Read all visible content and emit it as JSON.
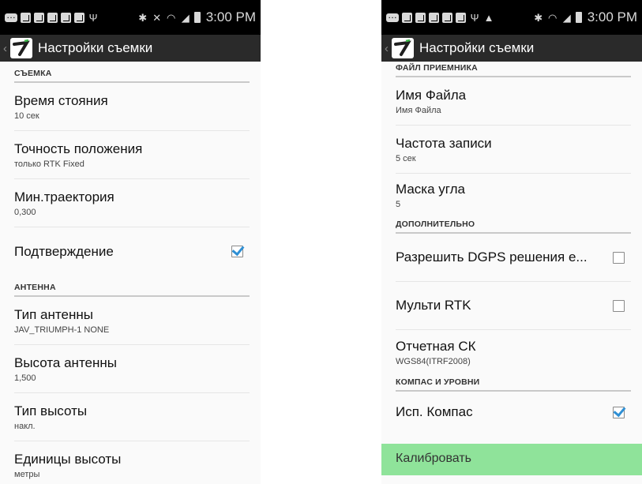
{
  "status": {
    "time": "3:00 PM"
  },
  "app": {
    "title": "Настройки съемки",
    "logo_icon": "app-logo-icon"
  },
  "left": {
    "section1": "СЪЕМКА",
    "items": [
      {
        "title": "Время стояния",
        "subtitle": "10 сек"
      },
      {
        "title": "Точность положения",
        "subtitle": "только RTK Fixed"
      },
      {
        "title": "Мин.траектория",
        "subtitle": "0,300"
      }
    ],
    "confirm": {
      "title": "Подтверждение",
      "checked": true
    },
    "section2": "АНТЕННА",
    "items2": [
      {
        "title": "Тип антенны",
        "subtitle": "JAV_TRIUMPH-1 NONE"
      },
      {
        "title": "Высота антенны",
        "subtitle": "1,500"
      },
      {
        "title": "Тип высоты",
        "subtitle": "накл."
      },
      {
        "title": "Единицы высоты",
        "subtitle": "метры"
      }
    ]
  },
  "right": {
    "section1": "ФАЙЛ ПРИЕМНИКА",
    "items": [
      {
        "title": "Имя Файла",
        "subtitle": "Имя Файла"
      },
      {
        "title": "Частота записи",
        "subtitle": "5 сек"
      },
      {
        "title": "Маска угла",
        "subtitle": "5"
      }
    ],
    "section2": "ДОПОЛНИТЕЛЬНО",
    "dgps": {
      "title": "Разрешить DGPS решения е...",
      "checked": false
    },
    "multi_rtk": {
      "title": "Мульти RTK",
      "checked": false
    },
    "report": {
      "title": "Отчетная СК",
      "subtitle": "WGS84(ITRF2008)"
    },
    "section3": "КОМПАС И УРОВНИ",
    "compass": {
      "title": "Исп. Компас",
      "checked": true
    },
    "calibrate": "Калибровать"
  },
  "colors": {
    "accent": "#2f8fd4",
    "highlight": "#8fe39a",
    "actionbar": "#2a2a2a"
  }
}
